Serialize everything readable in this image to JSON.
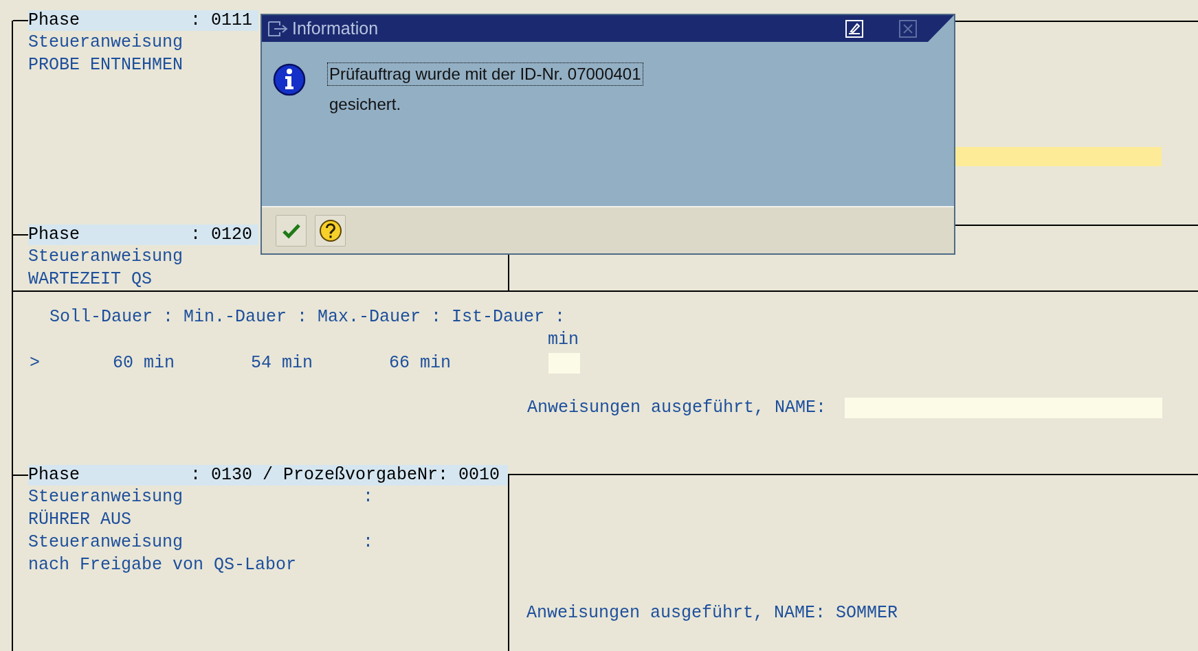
{
  "phases": [
    {
      "label": "Phase",
      "value": ": 0111",
      "lines": [
        {
          "text": "Steueranweisung"
        },
        {
          "text": "PROBE ENTNEHMEN"
        }
      ],
      "panel": {
        "kind": "required"
      }
    },
    {
      "label": "Phase",
      "value": ": 0120",
      "lines": [
        {
          "text": "Steueranweisung"
        },
        {
          "text": "WARTEZEIT QS"
        }
      ]
    }
  ],
  "durations": {
    "header": "Soll-Dauer : Min.-Dauer : Max.-Dauer : Ist-Dauer :",
    "unit": "min",
    "marker": ">",
    "values": [
      "60 min",
      "54 min",
      "66 min"
    ],
    "completion_label": "Anweisungen ausgeführt, NAME:"
  },
  "last_phase": {
    "label": "Phase",
    "value": ": 0130 / ProzeßvorgabeNr: 0010",
    "lines": [
      {
        "text": "Steueranweisung",
        "suffix": ":"
      },
      {
        "text": "RÜHRER AUS"
      },
      {
        "text": "Steueranweisung",
        "suffix": ":"
      },
      {
        "text": "nach Freigabe von QS-Labor"
      }
    ],
    "panel": {
      "label": "Anweisungen ausgeführt, NAME:",
      "value": "SOMMER"
    }
  },
  "dialog": {
    "title": "Information",
    "message_lines": [
      {
        "text": "Prüfauftrag wurde mit der ID-Nr. 07000401",
        "focused": true
      },
      {
        "text": "gesichert.",
        "focused": false
      }
    ],
    "buttons": [
      {
        "kind": "confirm"
      },
      {
        "kind": "help"
      }
    ]
  }
}
